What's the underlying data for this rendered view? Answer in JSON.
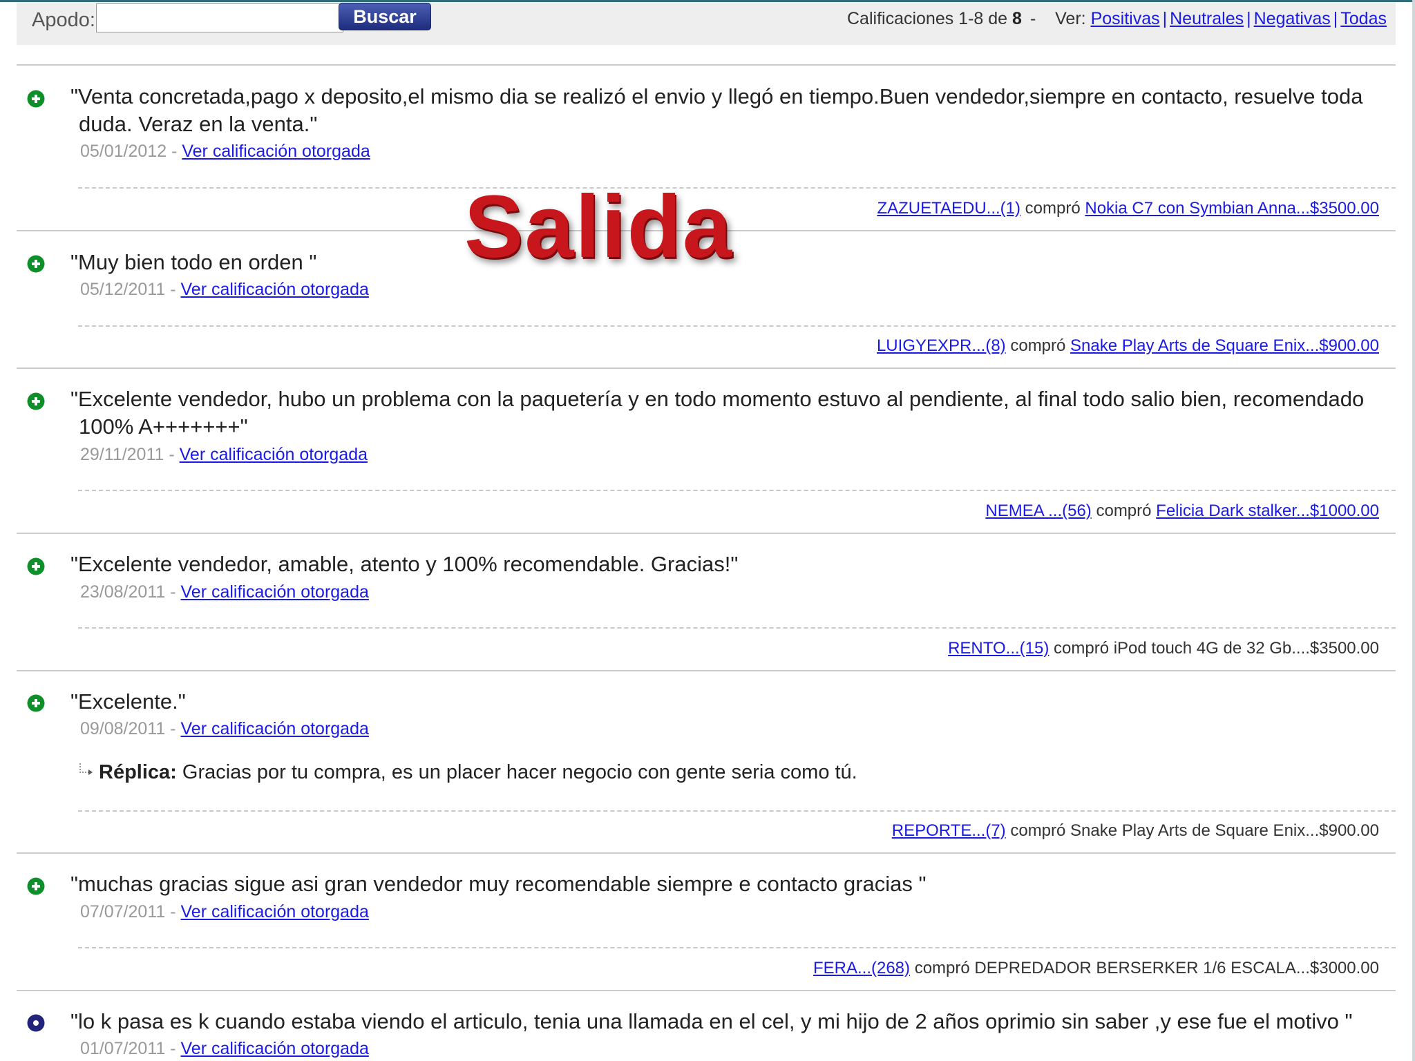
{
  "search": {
    "label": "Apodo:",
    "value": "",
    "placeholder": "",
    "button_label": "Buscar"
  },
  "summary": {
    "text": "Calificaciones 1-8 de",
    "total": "8",
    "dash": "-",
    "view_label": "Ver:"
  },
  "view_filters": [
    "Positivas",
    "Neutrales",
    "Negativas",
    "Todas"
  ],
  "watermark": "Salida",
  "link_label": "Ver calificación otorgada",
  "bought_label": "compró",
  "colors": {
    "positive": "#0f8f2a",
    "neutral": "#22237a",
    "link": "#1a1ae6"
  },
  "ratings": [
    {
      "type": "positive",
      "icon": "plus-circle-icon",
      "comment": "\"Venta concretada,pago x deposito,el mismo dia se realizó el envio y llegó en tiempo.Buen vendedor,siempre en contacto, resuelve toda duda. Veraz en la venta.\"",
      "date": "05/01/2012 -",
      "buyer": "ZAZUETAEDU...(1)",
      "item": "Nokia C7 con Symbian Anna...$3500.00"
    },
    {
      "type": "positive",
      "icon": "plus-circle-icon",
      "comment": "\"Muy bien todo en orden \"",
      "date": "05/12/2011 -",
      "buyer": "LUIGYEXPR...(8)",
      "item": "Snake Play Arts de Square Enix...$900.00"
    },
    {
      "type": "positive",
      "icon": "plus-circle-icon",
      "comment": "\"Excelente vendedor, hubo un problema con la paquetería y en todo momento estuvo al pendiente, al final todo salio bien, recomendado 100% A+++++++\"",
      "date": "29/11/2011 -",
      "buyer": "NEMEA ...(56)",
      "item": "Felicia Dark stalker...$1000.00"
    },
    {
      "type": "positive",
      "icon": "plus-circle-icon",
      "comment": "\"Excelente vendedor, amable, atento y 100% recomendable. Gracias!\"",
      "date": "23/08/2011 -",
      "buyer": "RENTO...(15)",
      "item": "iPod touch 4G de 32 Gb....$3500.00"
    },
    {
      "type": "positive",
      "icon": "plus-circle-icon",
      "comment": "\"Excelente.\"",
      "date": "09/08/2011 -",
      "reply_label": "Réplica:",
      "reply_text": "Gracias por tu compra, es un placer hacer negocio con gente seria como tú.",
      "buyer": "REPORTE...(7)",
      "item": "Snake Play Arts de Square Enix...$900.00"
    },
    {
      "type": "positive",
      "icon": "plus-circle-icon",
      "comment": "\"muchas gracias sigue asi gran vendedor muy recomendable siempre e contacto gracias \"",
      "date": "07/07/2011 -",
      "buyer": "FERA...(268)",
      "item": "DEPREDADOR BERSERKER 1/6 ESCALA...$3000.00"
    },
    {
      "type": "neutral",
      "icon": "dot-circle-icon",
      "comment": "\"lo k pasa es k cuando estaba viendo el articulo, tenia una llamada en el cel, y mi hijo de 2 años oprimio sin saber ,y ese fue el motivo \"",
      "date": "01/07/2011 -"
    }
  ]
}
